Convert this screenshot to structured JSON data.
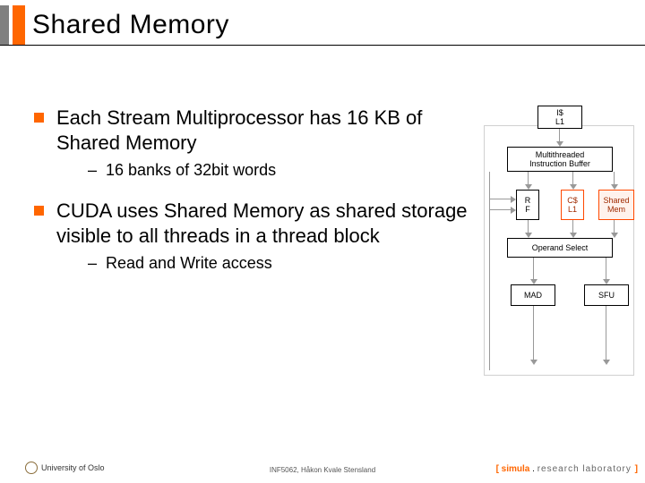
{
  "title": "Shared Memory",
  "bullets": [
    {
      "text": "Each Stream Multiprocessor has 16 KB of Shared Memory",
      "sub": "16 banks of 32bit words"
    },
    {
      "text": "CUDA uses Shared Memory as shared storage visible to all threads in a thread block",
      "sub": "Read and Write access"
    }
  ],
  "diagram": {
    "icache": "I$\nL1",
    "mib": "Multithreaded\nInstruction Buffer",
    "rf": "R\nF",
    "ccache": "C$\nL1",
    "shared": "Shared\nMem",
    "opselect": "Operand Select",
    "mad": "MAD",
    "sfu": "SFU"
  },
  "footer": {
    "left": "University of Oslo",
    "mid": "INF5062, Håkon Kvale Stensland",
    "right_brackets": [
      "[",
      "]"
    ],
    "right_brand": " simula ",
    "right_dot": ". ",
    "right_lab": "research laboratory "
  }
}
